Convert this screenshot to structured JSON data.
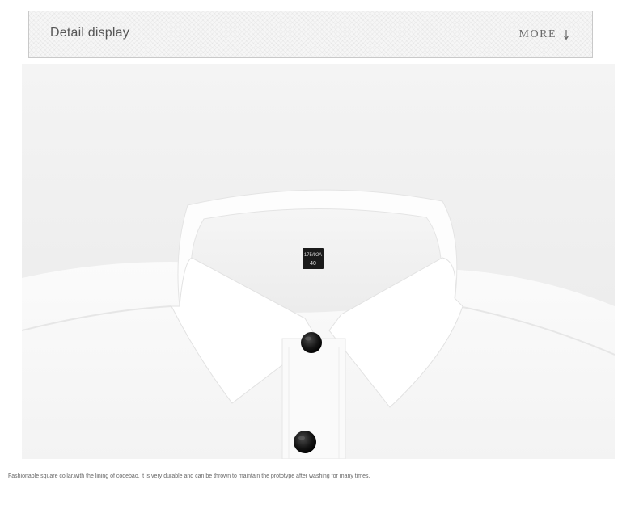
{
  "header": {
    "title": "Detail display",
    "more_label": "MORE",
    "more_icon": "arrow-down-icon"
  },
  "photo": {
    "label_line1": "175/92A",
    "label_line2": "40"
  },
  "caption": {
    "text": "Fashionable square collar,with the lining of codebao, it is very durable and can be thrown to maintain the prototype after washing for many times."
  },
  "colors": {
    "header_border": "#c9c9c9",
    "header_text": "#555555",
    "shirt_white": "#ffffff",
    "button_black": "#111111"
  }
}
